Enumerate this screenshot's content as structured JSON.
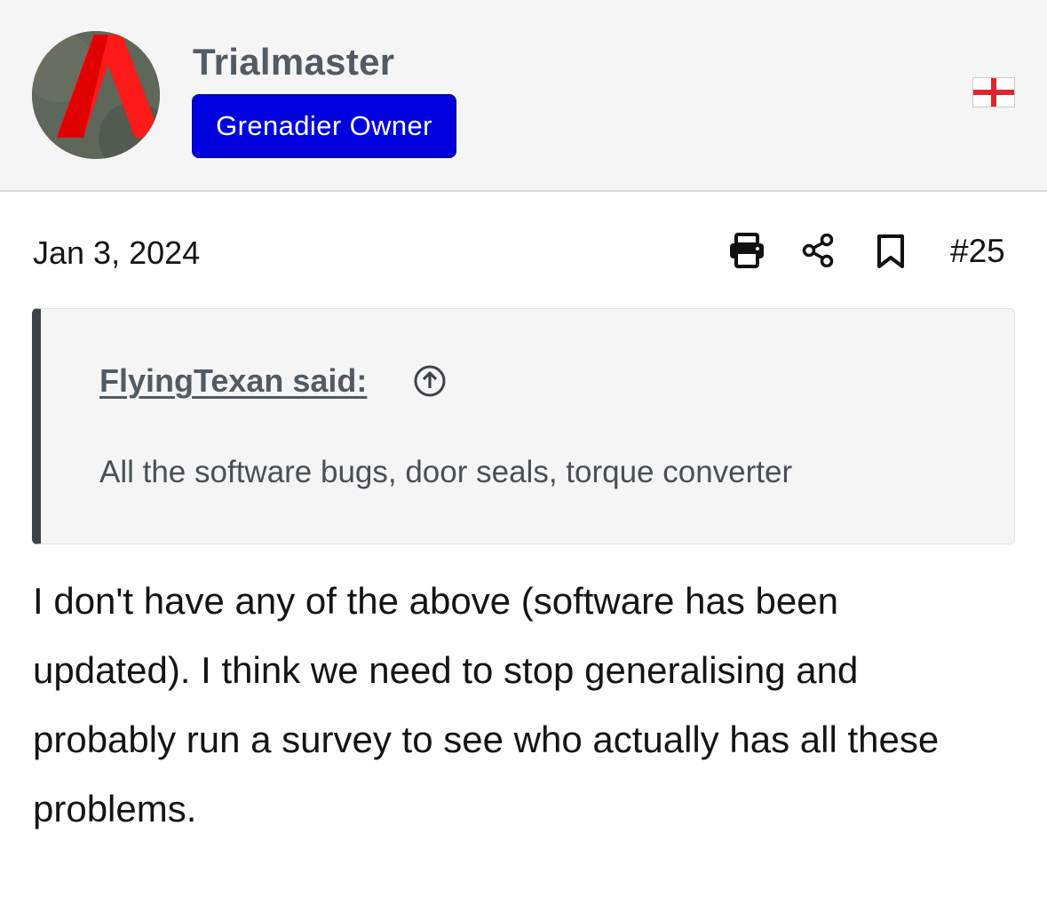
{
  "user": {
    "name": "Trialmaster",
    "badge": "Grenadier Owner",
    "avatar_icon": "red-a-logo",
    "flag_icon": "england-flag",
    "badge_color": "#0000de"
  },
  "post": {
    "date": "Jan 3, 2024",
    "number": "#25",
    "actions": [
      "print-icon",
      "share-icon",
      "bookmark-icon"
    ],
    "quote": {
      "author": "FlyingTexan said:",
      "jump_icon": "arrow-up-circle-icon",
      "text": "All the software bugs, door seals, torque converter"
    },
    "body": "I don't have any of the above (software has been updated). I think we need to stop generalising and probably run a survey to see who actually has all these problems."
  }
}
